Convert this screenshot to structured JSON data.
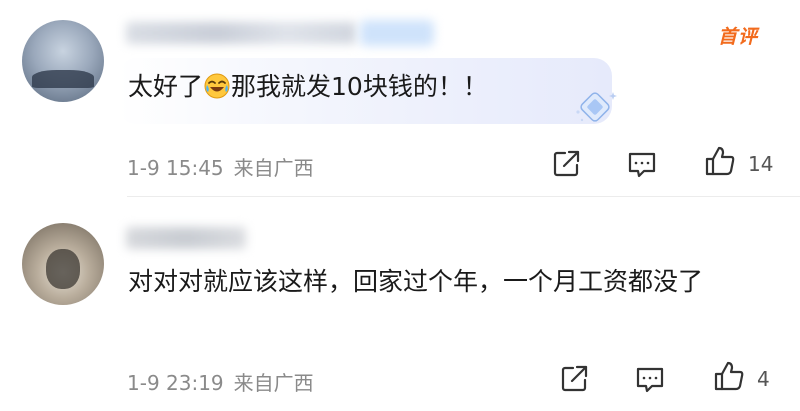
{
  "comments": [
    {
      "text_before": "太好了",
      "emoji": "laughing-crying-emoji",
      "text_after": "那我就发10块钱的！！",
      "date": "1-9 15:45",
      "location": "来自广西",
      "likes": "14",
      "badge": "首评"
    },
    {
      "text": "对对对就应该这样，回家过个年，一个月工资都没了",
      "date": "1-9 23:19",
      "location": "来自广西",
      "likes": "4"
    }
  ],
  "colors": {
    "badge": "#f26b1d",
    "meta_text": "#8a8a8a",
    "icon": "#333333"
  },
  "icons": [
    "share-icon",
    "reply-icon",
    "thumbs-up-icon"
  ]
}
